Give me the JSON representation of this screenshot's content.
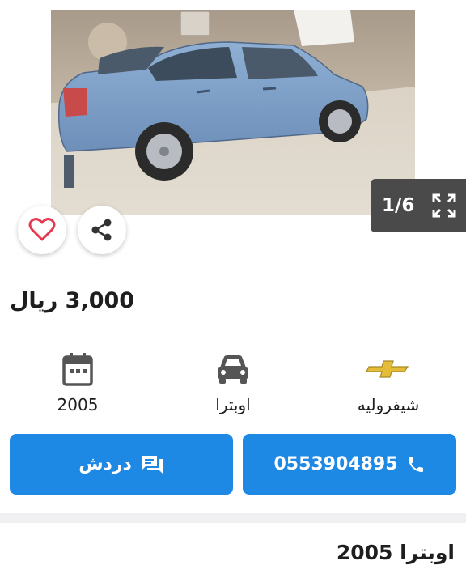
{
  "gallery": {
    "counter": "1/6",
    "photo_alt": "car-photo",
    "icons": {
      "prev": "chevron-left-icon",
      "next": "chevron-right-icon",
      "expand": "fullscreen-icon"
    }
  },
  "actions": {
    "favorite_icon": "heart-icon",
    "share_icon": "share-icon"
  },
  "listing": {
    "price": "3,000 ريال",
    "specs": [
      {
        "icon": "calendar-icon",
        "label": "2005"
      },
      {
        "icon": "car-icon",
        "label": "اوبترا"
      },
      {
        "icon": "chevrolet-logo",
        "label": "شيفروليه"
      }
    ],
    "title": "اوبترا 2005"
  },
  "buttons": {
    "chat_label": "دردش",
    "call_label": "0553904895",
    "chat_icon": "chat-icon",
    "call_icon": "phone-icon"
  },
  "colors": {
    "primary": "#1e88e5",
    "heart": "#e53950",
    "counter_bg": "#4a4a4a",
    "car": "#7c9fc7"
  }
}
